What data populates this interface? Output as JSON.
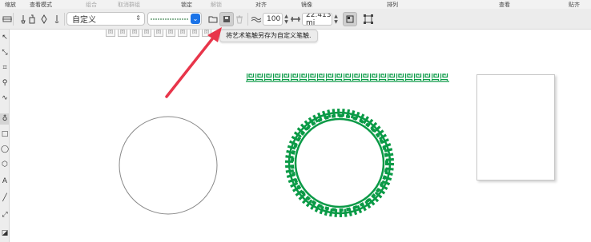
{
  "menubar": {
    "items": [
      {
        "label": "缩放",
        "enabled": true
      },
      {
        "label": "查看模式",
        "enabled": true
      },
      {
        "label": "组合",
        "enabled": false
      },
      {
        "label": "取消群组",
        "enabled": false
      },
      {
        "label": "锁定",
        "enabled": true
      },
      {
        "label": "解锁",
        "enabled": false
      },
      {
        "label": "对齐",
        "enabled": true
      },
      {
        "label": "镜像",
        "enabled": true
      },
      {
        "label": "排列",
        "enabled": true
      },
      {
        "label": "查看",
        "enabled": true
      },
      {
        "label": "贴齐",
        "enabled": true
      }
    ]
  },
  "propbar": {
    "preset_select": {
      "value": "自定义"
    },
    "stroke_width": "100",
    "size_field": "22.413 mi"
  },
  "tooltip": {
    "text": "将艺术笔触另存为自定义笔触."
  },
  "colors": {
    "accent": "#1a73e8",
    "border_green": "#0a9a46",
    "arrow_red": "#e8354a"
  },
  "tools": [
    {
      "name": "pick-tool-icon"
    },
    {
      "name": "shape-tool-icon"
    },
    {
      "name": "crop-tool-icon"
    },
    {
      "name": "zoom-tool-icon"
    },
    {
      "name": "freehand-tool-icon"
    },
    {
      "name": "artistic-media-tool-icon",
      "active": true
    },
    {
      "name": "rectangle-tool-icon"
    },
    {
      "name": "ellipse-tool-icon"
    },
    {
      "name": "polygon-tool-icon"
    },
    {
      "name": "text-tool-icon"
    },
    {
      "name": "line-tool-icon"
    },
    {
      "name": "connector-tool-icon"
    },
    {
      "name": "shadow-tool-icon"
    }
  ]
}
